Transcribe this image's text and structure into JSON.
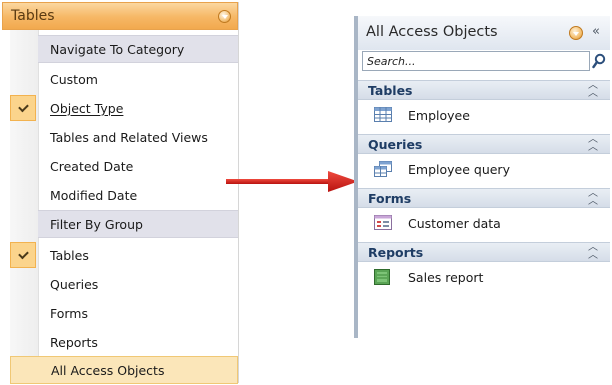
{
  "menu": {
    "title": "Tables",
    "groups": [
      {
        "label": "Navigate To Category"
      },
      {
        "label": "Filter By Group"
      }
    ],
    "category_items": [
      {
        "label": "Custom",
        "checked": false
      },
      {
        "label": "Object Type",
        "checked": true
      },
      {
        "label": "Tables and Related Views",
        "checked": false
      },
      {
        "label": "Created Date",
        "checked": false
      },
      {
        "label": "Modified Date",
        "checked": false
      }
    ],
    "filter_items": [
      {
        "label": "Tables",
        "checked": true
      },
      {
        "label": "Queries",
        "checked": false
      },
      {
        "label": "Forms",
        "checked": false
      },
      {
        "label": "Reports",
        "checked": false
      },
      {
        "label": "All Access Objects",
        "checked": false
      }
    ]
  },
  "pane": {
    "title": "All Access Objects",
    "search_placeholder": "Search...",
    "sections": [
      {
        "title": "Tables",
        "item": "Employee",
        "icon": "table-icon"
      },
      {
        "title": "Queries",
        "item": "Employee query",
        "icon": "query-icon"
      },
      {
        "title": "Forms",
        "item": "Customer data",
        "icon": "form-icon"
      },
      {
        "title": "Reports",
        "item": "Sales report",
        "icon": "report-icon"
      }
    ]
  },
  "colors": {
    "menu_header": "#f6b765",
    "selected_row": "#fbe6b9",
    "section_title": "#1e3c64",
    "arrow": "#d9201c"
  }
}
